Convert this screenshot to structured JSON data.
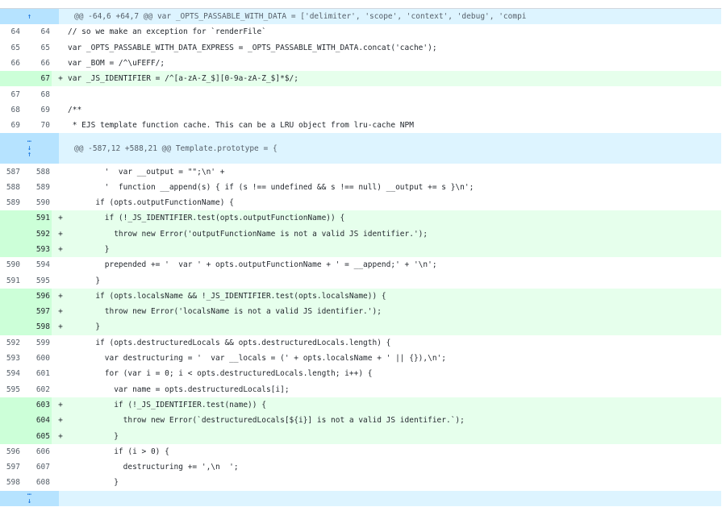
{
  "diff": {
    "hunk1": {
      "header": "@@ -64,6 +64,7 @@ var _OPTS_PASSABLE_WITH_DATA = ['delimiter', 'scope', 'context', 'debug', 'compi"
    },
    "hunk2": {
      "header": "@@ -587,12 +588,21 @@ Template.prototype = {"
    },
    "icons": {
      "expand_up": "↑",
      "expand_down": "↓",
      "dots": "⋯"
    },
    "lines1": [
      {
        "old": "64",
        "new": "64",
        "sign": "",
        "type": "ctx",
        "code": "// so we make an exception for `renderFile`"
      },
      {
        "old": "65",
        "new": "65",
        "sign": "",
        "type": "ctx",
        "code": "var _OPTS_PASSABLE_WITH_DATA_EXPRESS = _OPTS_PASSABLE_WITH_DATA.concat('cache');"
      },
      {
        "old": "66",
        "new": "66",
        "sign": "",
        "type": "ctx",
        "code": "var _BOM = /^\\uFEFF/;"
      },
      {
        "old": "",
        "new": "67",
        "sign": "+",
        "type": "add",
        "code": "var _JS_IDENTIFIER = /^[a-zA-Z_$][0-9a-zA-Z_$]*$/;"
      },
      {
        "old": "67",
        "new": "68",
        "sign": "",
        "type": "ctx",
        "code": ""
      },
      {
        "old": "68",
        "new": "69",
        "sign": "",
        "type": "ctx",
        "code": "/**"
      },
      {
        "old": "69",
        "new": "70",
        "sign": "",
        "type": "ctx",
        "code": " * EJS template function cache. This can be a LRU object from lru-cache NPM"
      }
    ],
    "lines2": [
      {
        "old": "587",
        "new": "588",
        "sign": "",
        "type": "ctx",
        "code": "        '  var __output = \"\";\\n' +"
      },
      {
        "old": "588",
        "new": "589",
        "sign": "",
        "type": "ctx",
        "code": "        '  function __append(s) { if (s !== undefined && s !== null) __output += s }\\n';"
      },
      {
        "old": "589",
        "new": "590",
        "sign": "",
        "type": "ctx",
        "code": "      if (opts.outputFunctionName) {"
      },
      {
        "old": "",
        "new": "591",
        "sign": "+",
        "type": "add",
        "code": "        if (!_JS_IDENTIFIER.test(opts.outputFunctionName)) {"
      },
      {
        "old": "",
        "new": "592",
        "sign": "+",
        "type": "add",
        "code": "          throw new Error('outputFunctionName is not a valid JS identifier.');"
      },
      {
        "old": "",
        "new": "593",
        "sign": "+",
        "type": "add",
        "code": "        }"
      },
      {
        "old": "590",
        "new": "594",
        "sign": "",
        "type": "ctx",
        "code": "        prepended += '  var ' + opts.outputFunctionName + ' = __append;' + '\\n';"
      },
      {
        "old": "591",
        "new": "595",
        "sign": "",
        "type": "ctx",
        "code": "      }"
      },
      {
        "old": "",
        "new": "596",
        "sign": "+",
        "type": "add",
        "code": "      if (opts.localsName && !_JS_IDENTIFIER.test(opts.localsName)) {"
      },
      {
        "old": "",
        "new": "597",
        "sign": "+",
        "type": "add",
        "code": "        throw new Error('localsName is not a valid JS identifier.');"
      },
      {
        "old": "",
        "new": "598",
        "sign": "+",
        "type": "add",
        "code": "      }"
      },
      {
        "old": "592",
        "new": "599",
        "sign": "",
        "type": "ctx",
        "code": "      if (opts.destructuredLocals && opts.destructuredLocals.length) {"
      },
      {
        "old": "593",
        "new": "600",
        "sign": "",
        "type": "ctx",
        "code": "        var destructuring = '  var __locals = (' + opts.localsName + ' || {}),\\n';"
      },
      {
        "old": "594",
        "new": "601",
        "sign": "",
        "type": "ctx",
        "code": "        for (var i = 0; i < opts.destructuredLocals.length; i++) {"
      },
      {
        "old": "595",
        "new": "602",
        "sign": "",
        "type": "ctx",
        "code": "          var name = opts.destructuredLocals[i];"
      },
      {
        "old": "",
        "new": "603",
        "sign": "+",
        "type": "add",
        "code": "          if (!_JS_IDENTIFIER.test(name)) {"
      },
      {
        "old": "",
        "new": "604",
        "sign": "+",
        "type": "add",
        "code": "            throw new Error(`destructuredLocals[${i}] is not a valid JS identifier.`);"
      },
      {
        "old": "",
        "new": "605",
        "sign": "+",
        "type": "add",
        "code": "          }"
      },
      {
        "old": "596",
        "new": "606",
        "sign": "",
        "type": "ctx",
        "code": "          if (i > 0) {"
      },
      {
        "old": "597",
        "new": "607",
        "sign": "",
        "type": "ctx",
        "code": "            destructuring += ',\\n  ';"
      },
      {
        "old": "598",
        "new": "608",
        "sign": "",
        "type": "ctx",
        "code": "          }"
      }
    ]
  }
}
